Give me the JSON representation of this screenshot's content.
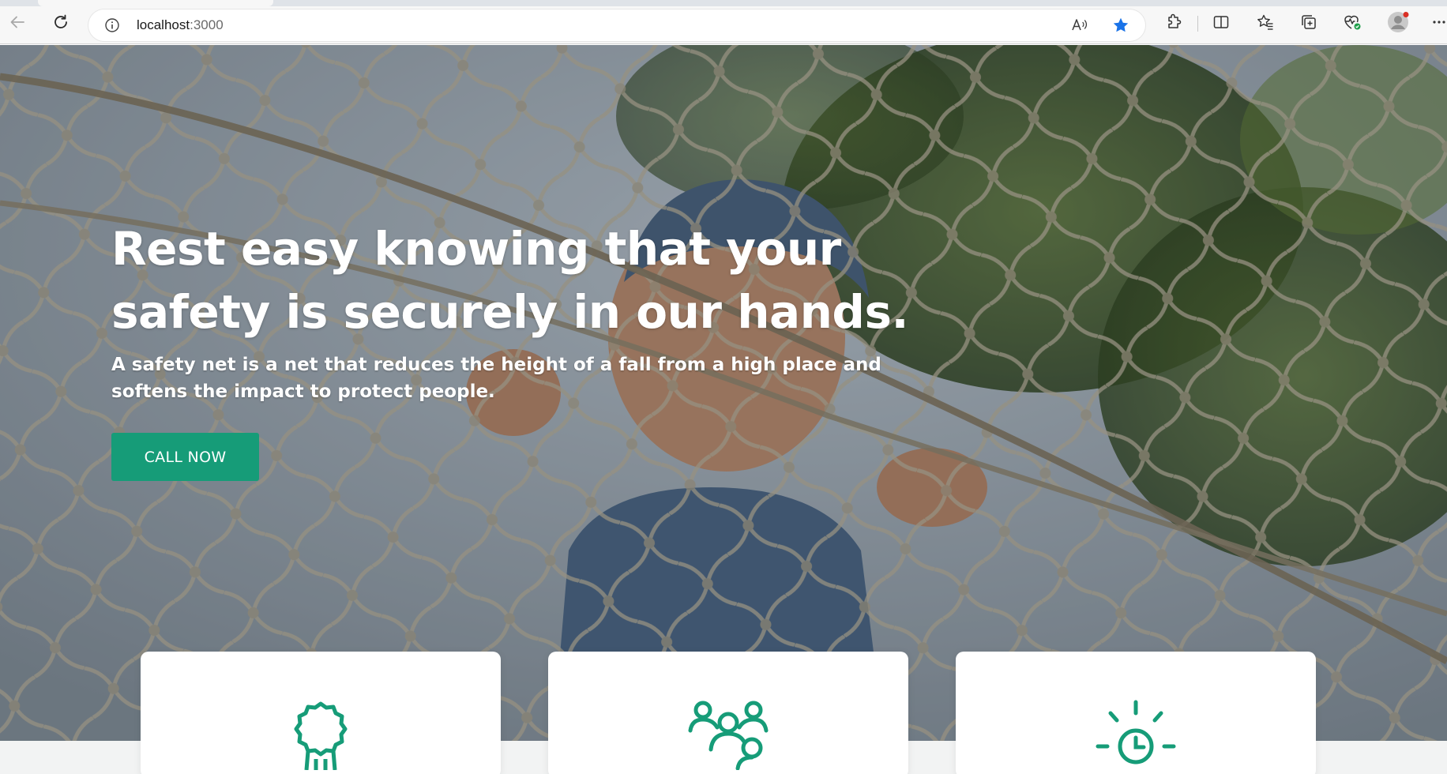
{
  "browser": {
    "url_host": "localhost",
    "url_port": ":3000",
    "icons": {
      "back": "back-arrow-icon",
      "reload": "reload-icon",
      "site_info": "info-icon",
      "read_aloud": "read-aloud-icon",
      "favorite": "star-filled-icon",
      "extensions": "puzzle-icon",
      "split_screen": "split-screen-icon",
      "favorites": "favorites-icon",
      "collections": "collections-icon",
      "browser_essentials": "heart-pulse-icon",
      "profile": "avatar",
      "more": "more-icon"
    },
    "accent": "#1a73e8"
  },
  "hero": {
    "title": "Rest easy knowing that your safety is securely in our hands.",
    "subtitle": "A safety net is a net that reduces the height of a fall from a high place and softens the impact to protect people.",
    "cta_label": "CALL NOW",
    "cta_color": "#169c78"
  },
  "features": {
    "icon_color": "#169c78",
    "cards": [
      {
        "icon": "award-badge-icon"
      },
      {
        "icon": "team-people-icon"
      },
      {
        "icon": "clock-sun-icon"
      }
    ]
  }
}
